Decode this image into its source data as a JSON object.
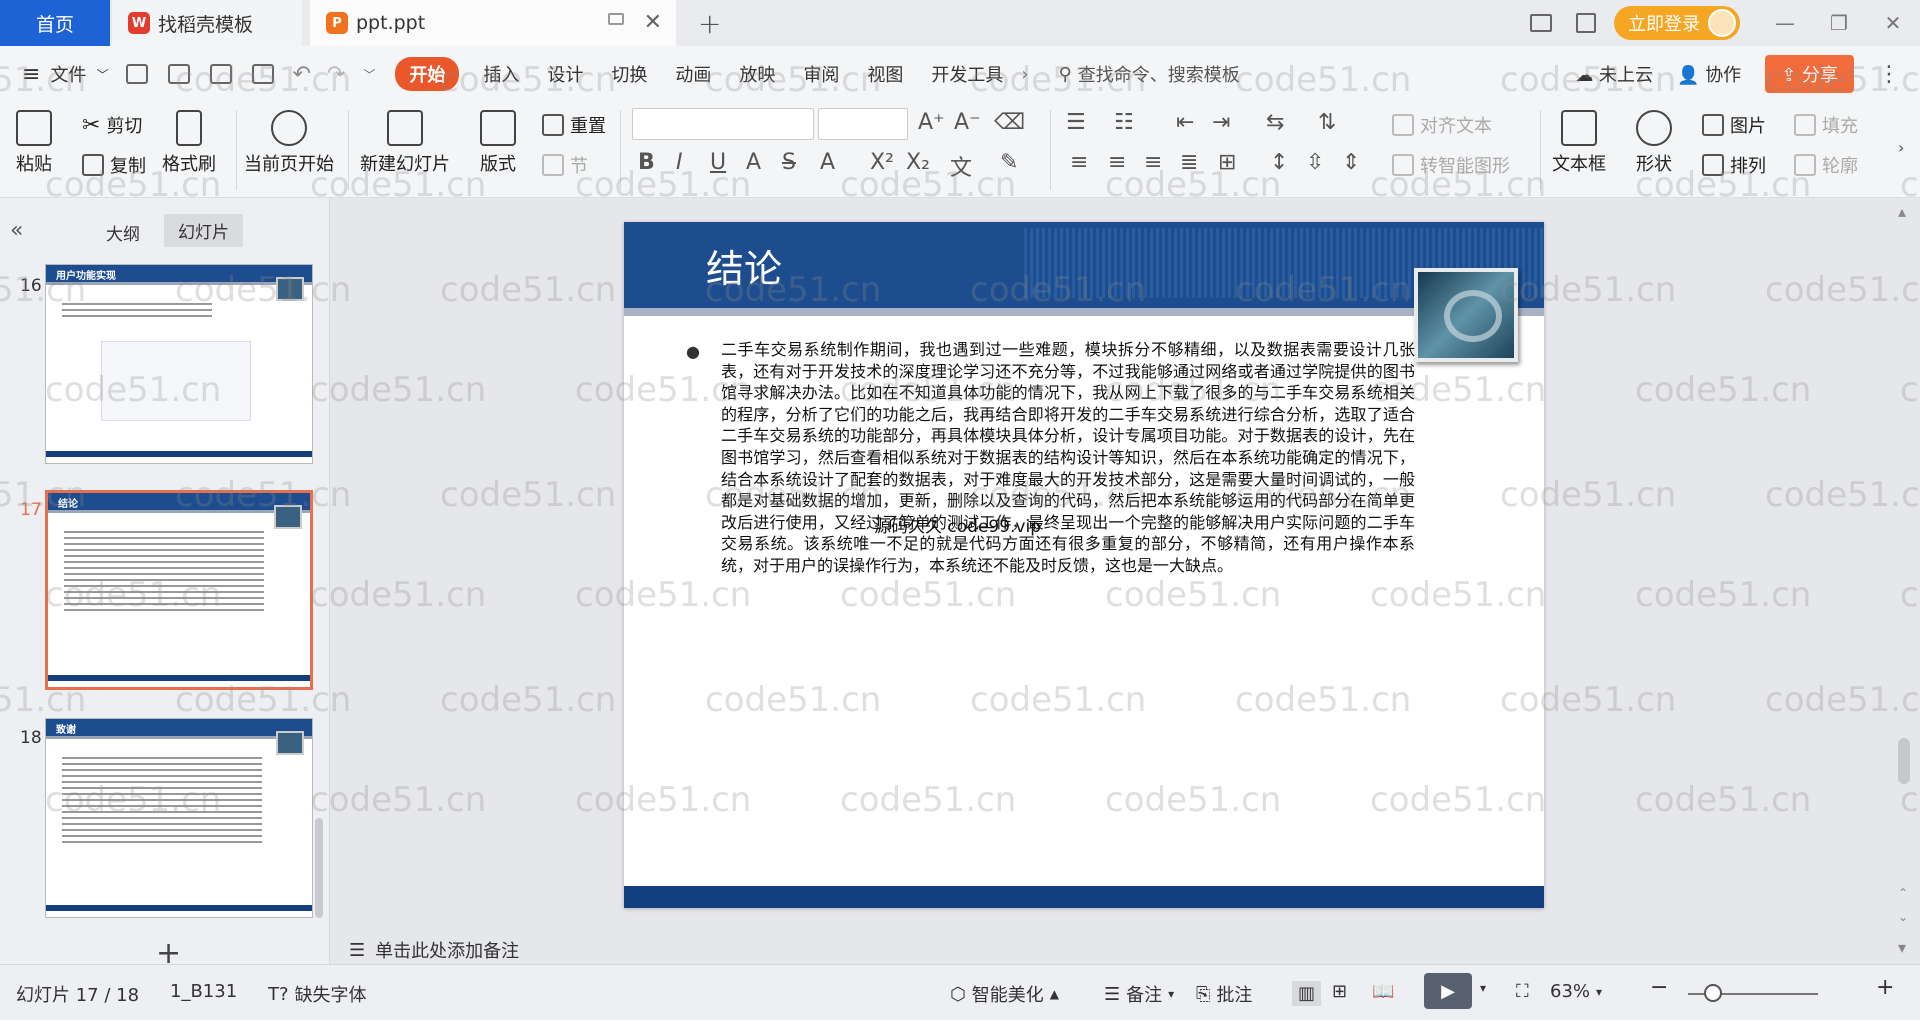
{
  "titlebar": {
    "tab_home": "首页",
    "tab_template": "找稻壳模板",
    "tab_ppt": "ppt.ppt",
    "newtab": "+",
    "login": "立即登录",
    "close": "✕"
  },
  "menubar": {
    "file": "文件",
    "items": [
      "开始",
      "插入",
      "设计",
      "切换",
      "动画",
      "放映",
      "审阅",
      "视图",
      "开发工具"
    ],
    "search": "查找命令、搜索模板",
    "cloud": "未上云",
    "collab": "协作",
    "share": "分享"
  },
  "ribbon": {
    "paste": "粘贴",
    "cut": "剪切",
    "copy": "复制",
    "format_painter": "格式刷",
    "from_current": "当前页开始",
    "new_slide": "新建幻灯片",
    "layout": "版式",
    "section": "节",
    "reset": "重置",
    "align_text": "对齐文本",
    "smart_art": "转智能图形",
    "textbox": "文本框",
    "shape": "形状",
    "image": "图片",
    "arrange": "排列",
    "fill": "填充",
    "outline": "轮廓"
  },
  "leftpanel": {
    "tab_outline": "大纲",
    "tab_slides": "幻灯片",
    "slides": [
      {
        "num": "16",
        "title": "用户功能实现"
      },
      {
        "num": "17",
        "title": "结论"
      },
      {
        "num": "18",
        "title": "致谢"
      }
    ]
  },
  "slide": {
    "title": "结论",
    "bullet": "●",
    "body": "二手车交易系统制作期间，我也遇到过一些难题，模块拆分不够精细，以及数据表需要设计几张表，还有对于开发技术的深度理论学习还不充分等，不过我能够通过网络或者通过学院提供的图书馆寻求解决办法。比如在不知道具体功能的情况下，我从网上下载了很多的与二手车交易系统相关的程序，分析了它们的功能之后，我再结合即将开发的二手车交易系统进行综合分析，选取了适合二手车交易系统的功能部分，再具体模块具体分析，设计专属项目功能。对于数据表的设计，先在图书馆学习，然后查看相似系统对于数据表的结构设计等知识，然后在本系统功能确定的情况下，结合本系统设计了配套的数据表，对于难度最大的开发技术部分，这是需要大量时间调试的，一般都是对基础数据的增加，更新，删除以及查询的代码，然后把本系统能够运用的代码部分在简单更改后进行使用，又经过了简单的测试工作，最终呈现出一个完整的能够解决用户实际问题的二手车交易系统。该系统唯一不足的就是代码方面还有很多重复的部分，不够精简，还有用户操作本系统，对于用户的误操作行为，本系统还不能及时反馈，这也是一大缺点。",
    "overlay": "源码久久 code99.vip"
  },
  "notes": "单击此处添加备注",
  "statusbar": {
    "slide_indicator": "幻灯片 17 / 18",
    "theme": "1_B131",
    "missing_font": "缺失字体",
    "beautify": "智能美化",
    "notes": "备注",
    "comment": "批注",
    "zoom": "63%"
  },
  "watermark": "code51.cn",
  "colors": {
    "brand": "#1e63d6",
    "accent": "#e9572a",
    "slide_blue": "#1d4d8e"
  }
}
